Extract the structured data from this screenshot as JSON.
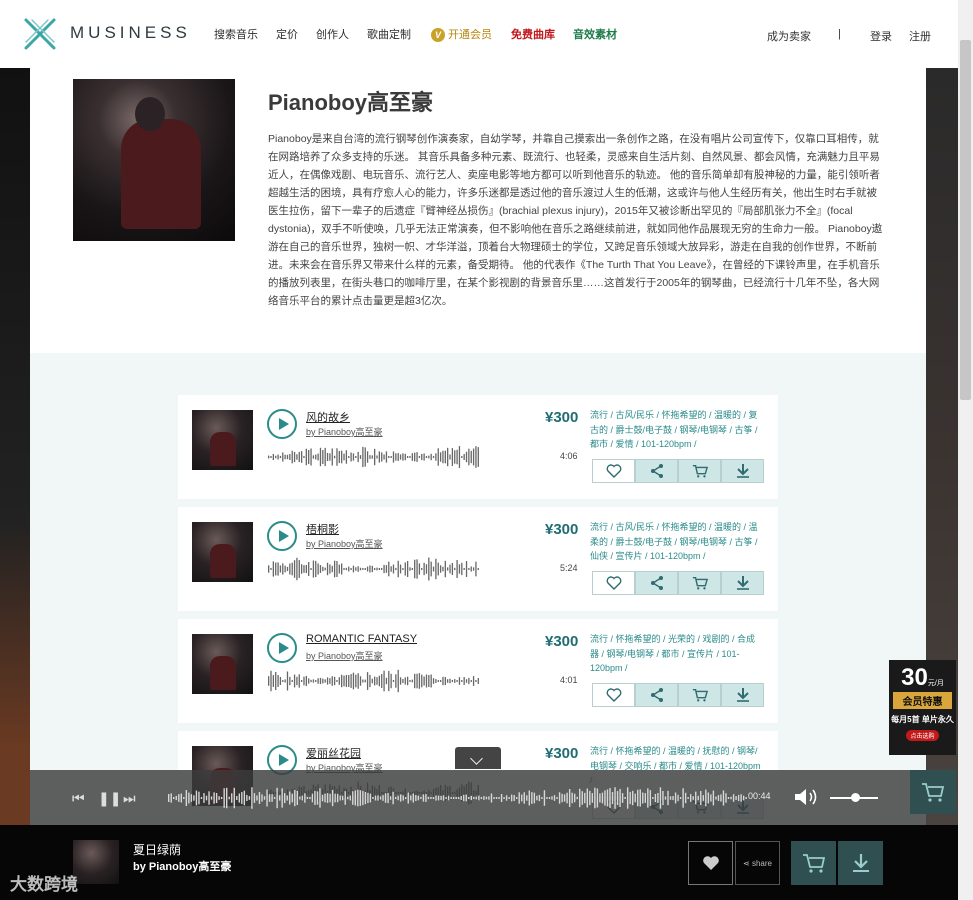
{
  "brand": {
    "name": "MUSINESS"
  },
  "nav": [
    {
      "label": "搜索音乐",
      "color": "#2d2d2d"
    },
    {
      "label": "定价",
      "color": "#2d2d2d"
    },
    {
      "label": "创作人",
      "color": "#2d2d2d"
    },
    {
      "label": "歌曲定制",
      "color": "#2d2d2d"
    },
    {
      "label": "开通会员",
      "color": "#b8860b",
      "badge": "V"
    },
    {
      "label": "免费曲库",
      "color": "#c0181e"
    },
    {
      "label": "音效素材",
      "color": "#1e7b4a"
    }
  ],
  "account": {
    "become_seller": "成为卖家",
    "separator": "|",
    "login": "登录",
    "register": "注册"
  },
  "artist": {
    "name": "Pianoboy高至豪",
    "bio": "Pianoboy是来自台湾的流行钢琴创作演奏家，自幼学琴，并靠自己摸索出一条创作之路，在没有唱片公司宣传下，仅靠口耳相传，就在网路培养了众多支持的乐迷。 其音乐具备多种元素、既流行、也轻柔，灵感来自生活片刻、自然风景、都会风情，充满魅力且平易近人，在偶像戏剧、电玩音乐、流行艺人、卖座电影等地方都可以听到他音乐的轨迹。 他的音乐简单却有股神秘的力量，能引领听者超越生活的困境，具有疗愈人心的能力，许多乐迷都是透过他的音乐渡过人生的低潮，这或许与他人生经历有关，他出生时右手就被医生拉伤，留下一辈子的后遗症『臂神经丛损伤』(brachial plexus injury)，2015年又被诊断出罕见的『局部肌张力不全』(focal dystonia)，双手不听使唤，几乎无法正常演奏，但不影响他在音乐之路继续前进，就如同他作品展现无穷的生命力一般。 Pianoboy遨游在自己的音乐世界，独树一帜、才华洋溢，顶着台大物理硕士的学位，又跨足音乐领域大放异彩，游走在自我的创作世界，不断前进。未来会在音乐界又带来什么样的元素，备受期待。 他的代表作《The Turth That You Leave》，在曾经的下课铃声里，在手机音乐的播放列表里，在街头巷口的咖啡厅里，在某个影视剧的背景音乐里……这首发行于2005年的钢琴曲，已经流行十几年不坠，各大网络音乐平台的累计点击量更是超3亿次。"
  },
  "tracks": [
    {
      "title": "风的故乡",
      "by": "by Pianoboy高至豪",
      "duration": "4:06",
      "price": "¥300",
      "tags": "流行 / 古风/民乐 / 怀拖希望的 / 温暖的 / 复古的 / 爵士鼓/电子鼓 / 钢琴/电钢琴 / 古筝 / 都市 / 爱情 / 101-120bpm /"
    },
    {
      "title": "梧桐影",
      "by": "by Pianoboy高至豪",
      "duration": "5:24",
      "price": "¥300",
      "tags": "流行 / 古风/民乐 / 怀拖希望的 / 温暖的 / 温柔的 / 爵士鼓/电子鼓 / 钢琴/电钢琴 / 古筝 / 仙侠 / 宣传片 / 101-120bpm /"
    },
    {
      "title": "ROMANTIC FANTASY",
      "by": "by Pianoboy高至豪",
      "duration": "4:01",
      "price": "¥300",
      "tags": "流行 / 怀拖希望的 / 光荣的 / 戏剧的 / 合成器 / 钢琴/电钢琴 / 都市 / 宣传片 / 101-120bpm /"
    },
    {
      "title": "爱丽丝花园",
      "by": "by Pianoboy高至豪",
      "duration": "",
      "price": "¥300",
      "tags": "流行 / 怀拖希望的 / 温暖的 / 抚慰的 / 钢琴/电钢琴 / 交响乐 / 都市 / 爱情 / 101-120bpm /"
    }
  ],
  "promo": {
    "price": "30",
    "unit": "元/月",
    "band": "会员特惠",
    "line": "每月5首 单片永久",
    "cta": "点击选购"
  },
  "player": {
    "time": "00:44"
  },
  "now_playing": {
    "title": "夏日绿荫",
    "artist": "by Pianoboy高至豪",
    "share_label": "share"
  },
  "watermark": "大数跨境",
  "colors": {
    "accent": "#2b8a8a",
    "price": "#1f6d72",
    "vip": "#b8860b",
    "free": "#c0181e"
  }
}
